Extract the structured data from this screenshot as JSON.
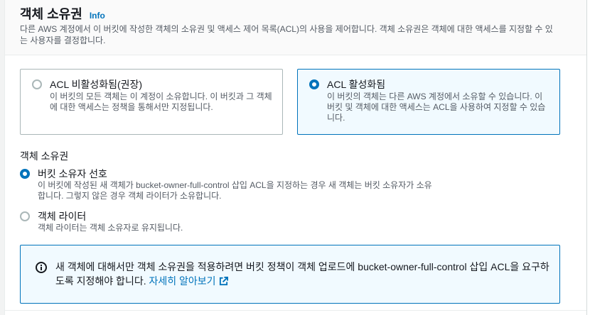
{
  "header": {
    "title": "객체 소유권",
    "info_link": "Info",
    "description": "다른 AWS 계정에서 이 버킷에 작성한 객체의 소유권 및 액세스 제어 목록(ACL)의 사용을 제어합니다. 객체 소유권은 객체에 대한 액세스를 지정할 수 있는 사용자를 결정합니다."
  },
  "acl_tiles": [
    {
      "label": "ACL 비활성화됨(권장)",
      "description": "이 버킷의 모든 객체는 이 계정이 소유합니다. 이 버킷과 그 객체에 대한 액세스는 정책을 통해서만 지정됩니다.",
      "selected": false
    },
    {
      "label": "ACL 활성화됨",
      "description": "이 버킷의 객체는 다른 AWS 계정에서 소유할 수 있습니다. 이 버킷 및 객체에 대한 액세스는 ACL을 사용하여 지정할 수 있습니다.",
      "selected": true
    }
  ],
  "ownership": {
    "label": "객체 소유권",
    "options": [
      {
        "label": "버킷 소유자 선호",
        "description": "이 버킷에 작성된 새 객체가 bucket-owner-full-control 삽입 ACL을 지정하는 경우 새 객체는 버킷 소유자가 소유합니다. 그렇지 않은 경우 객체 라이터가 소유합니다.",
        "selected": true
      },
      {
        "label": "객체 라이터",
        "description": "객체 라이터는 객체 소유자로 유지됩니다.",
        "selected": false
      }
    ]
  },
  "alert": {
    "text": "새 객체에 대해서만 객체 소유권을 적용하려면 버킷 정책이 객체 업로드에 bucket-owner-full-control 삽입 ACL을 요구하도록 지정해야 합니다.",
    "link": "자세히 알아보기",
    "icon": "info-icon",
    "link_icon": "external-link-icon"
  },
  "colors": {
    "accent": "#0073bb",
    "alert_bg": "#f1faff",
    "muted_text": "#545b64"
  }
}
